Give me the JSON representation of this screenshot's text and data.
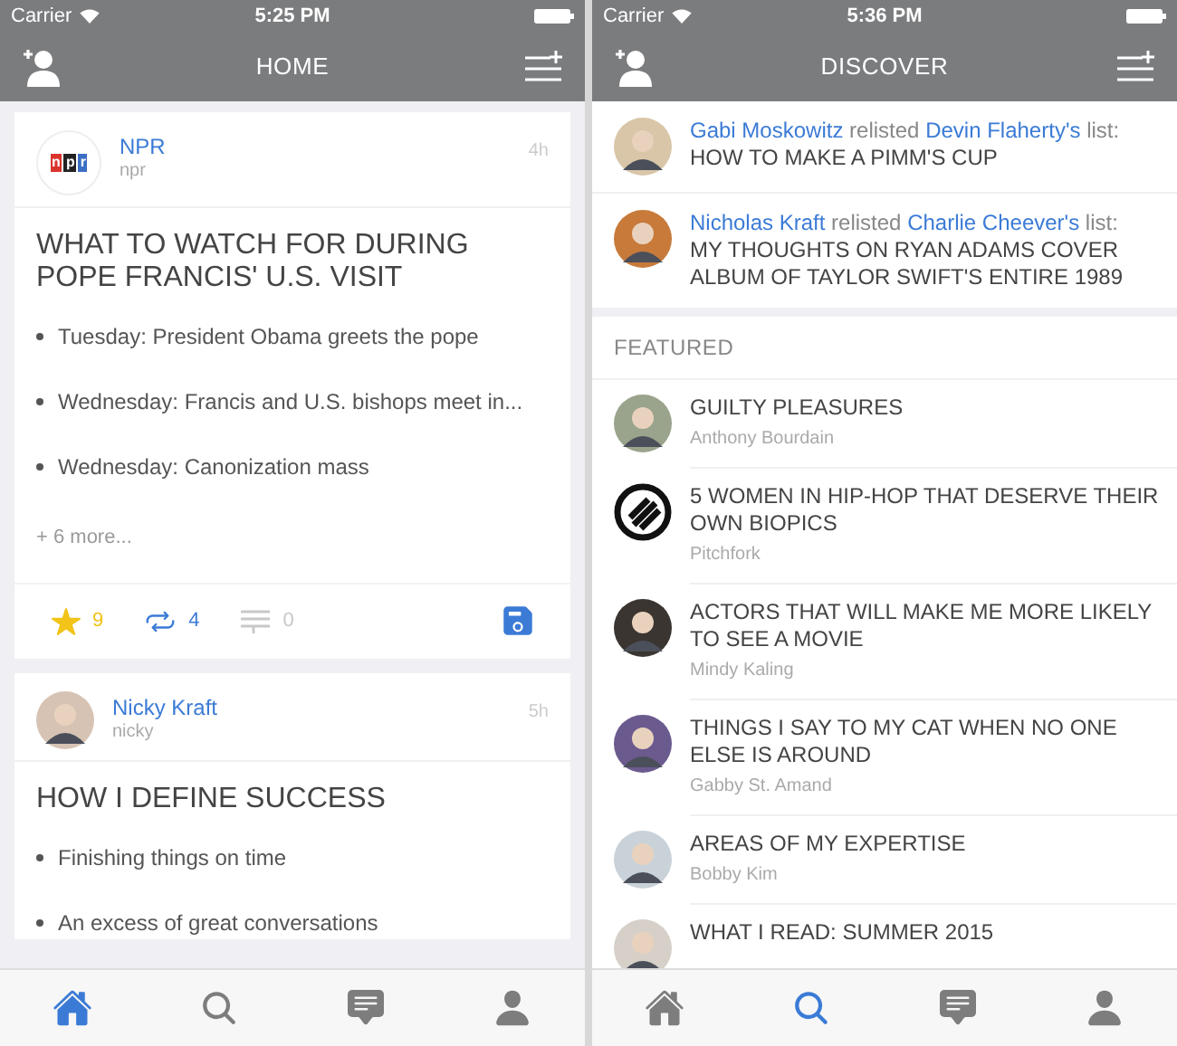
{
  "screens": [
    {
      "kind": "home",
      "status_bar": {
        "carrier": "Carrier",
        "time": "5:25 PM"
      },
      "nav": {
        "title": "HOME"
      },
      "cards": [
        {
          "author": "NPR",
          "handle": "npr",
          "time": "4h",
          "avatar": {
            "kind": "logo",
            "letters": [
              "n",
              "p",
              "r"
            ]
          },
          "title": "WHAT TO WATCH FOR DURING POPE FRANCIS' U.S. VISIT",
          "bullets": [
            "Tuesday: President Obama greets the pope",
            "Wednesday: Francis and U.S. bishops meet in...",
            "Wednesday: Canonization mass"
          ],
          "more": "+ 6 more...",
          "actions": [
            {
              "kind": "star",
              "count": "9",
              "active": true
            },
            {
              "kind": "relist",
              "count": "4",
              "active": true
            },
            {
              "kind": "comment",
              "count": "0",
              "active": false
            }
          ],
          "saved": true
        },
        {
          "author": "Nicky Kraft",
          "handle": "nicky",
          "time": "5h",
          "avatar": {
            "kind": "person"
          },
          "title": "HOW I DEFINE SUCCESS",
          "bullets": [
            "Finishing things on time",
            "An excess of great conversations"
          ]
        }
      ],
      "tabs": [
        {
          "kind": "home",
          "selected": true
        },
        {
          "kind": "search",
          "selected": false
        },
        {
          "kind": "messages",
          "selected": false
        },
        {
          "kind": "profile",
          "selected": false
        }
      ]
    },
    {
      "kind": "discover",
      "status_bar": {
        "carrier": "Carrier",
        "time": "5:36 PM"
      },
      "nav": {
        "title": "DISCOVER"
      },
      "activity": [
        {
          "actor": "Gabi Moskowitz",
          "verb": "relisted",
          "owner": "Devin Flaherty's",
          "suffix": "list:",
          "list": "HOW TO MAKE A PIMM'S CUP"
        },
        {
          "actor": "Nicholas Kraft",
          "verb": "relisted",
          "owner": "Charlie Cheever's",
          "suffix": "list:",
          "list": "MY THOUGHTS ON RYAN ADAMS COVER ALBUM OF TAYLOR SWIFT'S ENTIRE 1989"
        }
      ],
      "featured_header": "FEATURED",
      "featured": [
        {
          "title": "GUILTY PLEASURES",
          "author": "Anthony Bourdain",
          "avatar": {
            "kind": "person"
          }
        },
        {
          "title": "5 WOMEN IN HIP-HOP THAT DESERVE THEIR OWN BIOPICS",
          "author": "Pitchfork",
          "avatar": {
            "kind": "logo"
          }
        },
        {
          "title": "ACTORS THAT WILL MAKE ME MORE LIKELY TO SEE A MOVIE",
          "author": "Mindy Kaling",
          "avatar": {
            "kind": "person"
          }
        },
        {
          "title": "THINGS I SAY TO MY CAT WHEN NO ONE ELSE IS AROUND",
          "author": "Gabby St. Amand",
          "avatar": {
            "kind": "person"
          }
        },
        {
          "title": "AREAS OF MY EXPERTISE",
          "author": "Bobby Kim",
          "avatar": {
            "kind": "person"
          }
        },
        {
          "title": "WHAT I READ: SUMMER 2015",
          "avatar": {
            "kind": "person"
          }
        }
      ],
      "tabs": [
        {
          "kind": "home",
          "selected": false
        },
        {
          "kind": "search",
          "selected": true
        },
        {
          "kind": "messages",
          "selected": false
        },
        {
          "kind": "profile",
          "selected": false
        }
      ]
    }
  ]
}
